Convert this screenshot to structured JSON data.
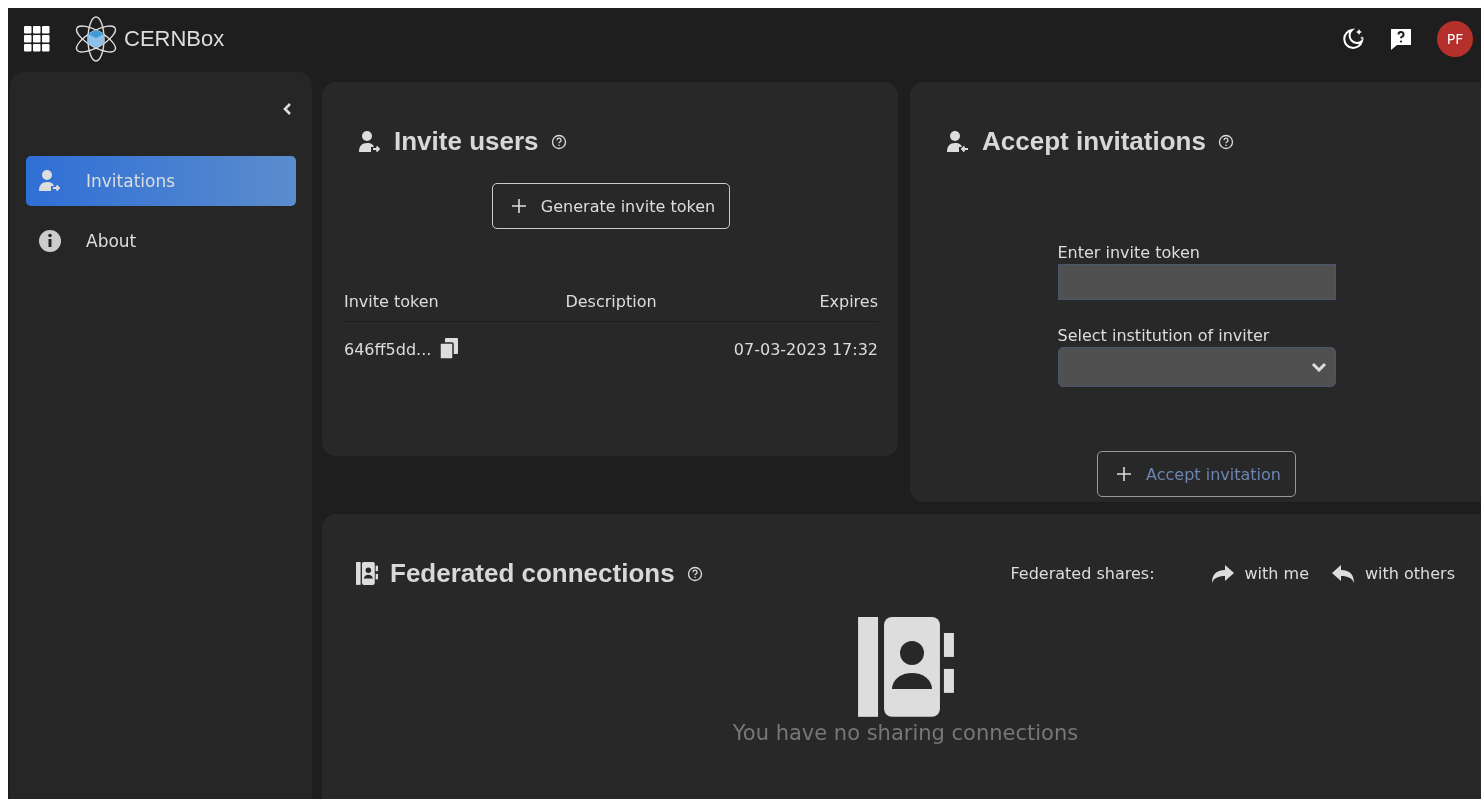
{
  "topbar": {
    "logo": "CERNBox",
    "avatar": "PF"
  },
  "sidebar": {
    "items": [
      {
        "label": "Invitations",
        "kind": "invite",
        "selected": true
      },
      {
        "label": "About",
        "kind": "info",
        "selected": false
      }
    ]
  },
  "invite": {
    "title": "Invite users",
    "button": "Generate invite token",
    "table": {
      "columns": [
        "Invite token",
        "Description",
        "Expires"
      ],
      "rows": [
        {
          "token": "646ff5dd...",
          "description": "",
          "expires": "07-03-2023 17:32"
        }
      ]
    }
  },
  "accept": {
    "title": "Accept invitations",
    "token_label": "Enter invite token",
    "institution_label": "Select institution of inviter",
    "button": {
      "label": "Accept invitation",
      "disabled": true
    }
  },
  "federated": {
    "title": "Federated connections",
    "shares_label": "Federated shares:",
    "links": [
      {
        "label": "with me",
        "kind": "forward"
      },
      {
        "label": "with others",
        "kind": "reply"
      }
    ],
    "empty": "You have no sharing connections"
  }
}
